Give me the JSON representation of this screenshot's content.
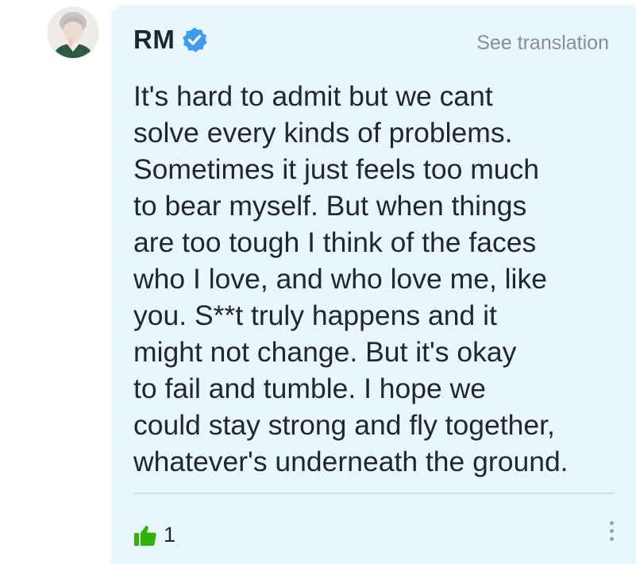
{
  "post": {
    "author": "RM",
    "verified_icon": "verified-badge-icon",
    "see_translation": "See translation",
    "body_lines": [
      "It's hard to admit but we cant",
      "solve every kinds of problems.",
      "Sometimes it just feels too much",
      "to bear myself. But when things",
      "are too tough I think of the faces",
      "who I love, and who love me, like",
      "you. S**t truly happens and it",
      "might not change. But it's okay",
      "to fail and tumble. I hope we",
      "could stay strong and fly together,",
      "whatever's underneath the ground."
    ],
    "likes": "1"
  },
  "colors": {
    "card_background": "#e8f7fd",
    "accent": "#2db400",
    "verified": "#3d9bf0",
    "secondary_text": "#8a8f93",
    "primary_text": "#22272b"
  },
  "icons": {
    "avatar": "user-avatar",
    "like": "thumbs-up-icon",
    "more": "more-vertical-icon"
  }
}
